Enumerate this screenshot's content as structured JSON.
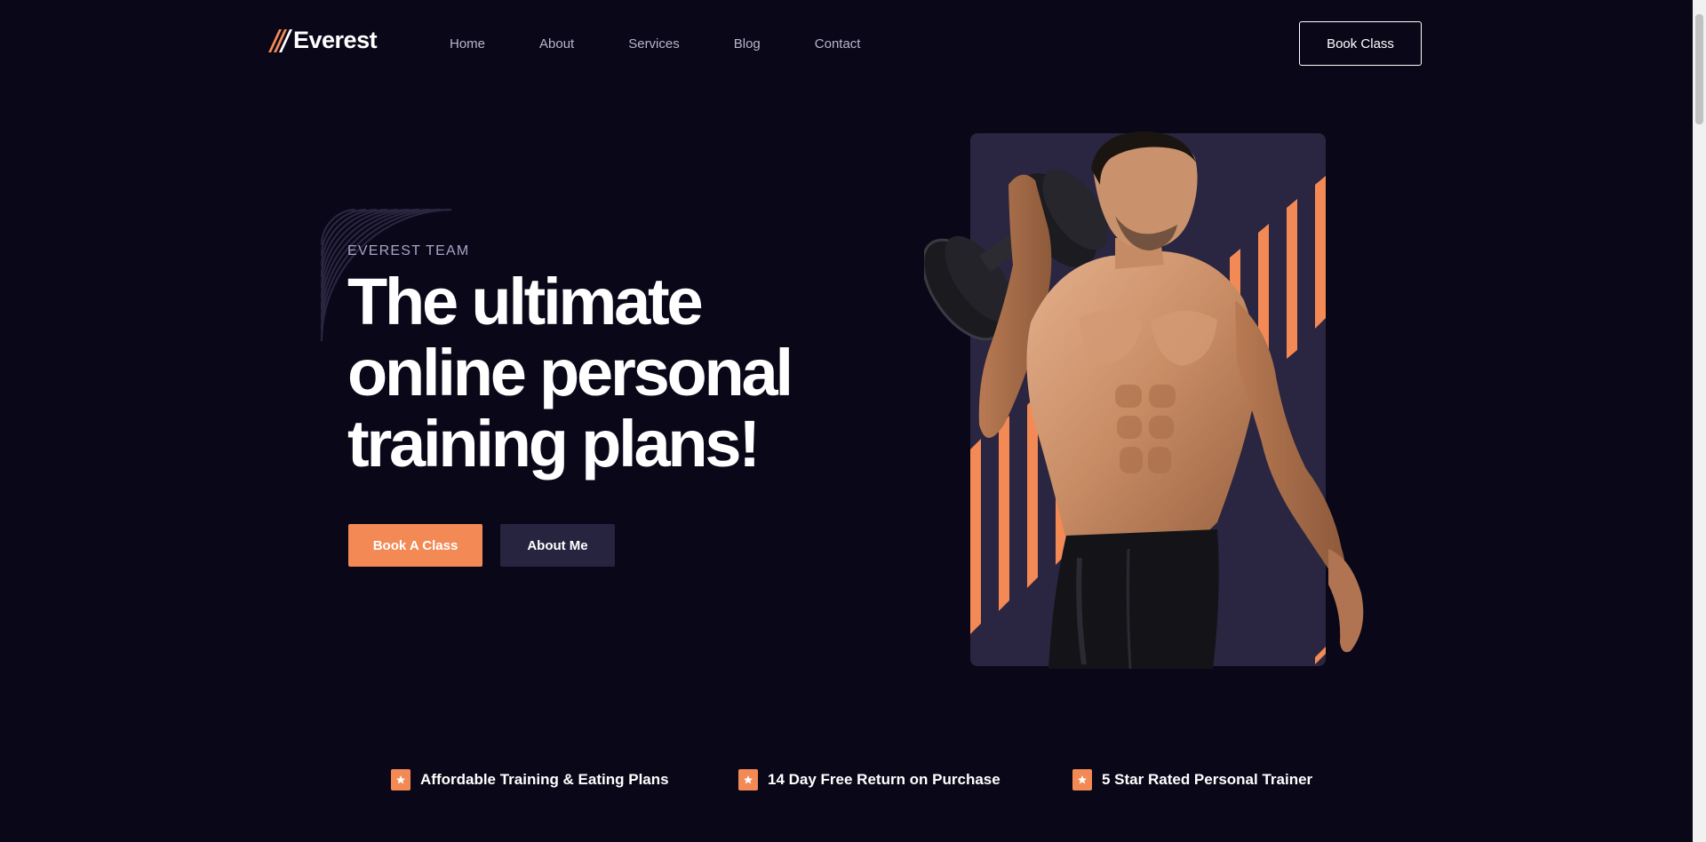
{
  "header": {
    "logo_text": "Everest",
    "nav": [
      "Home",
      "About",
      "Services",
      "Blog",
      "Contact"
    ],
    "cta_label": "Book Class"
  },
  "hero": {
    "eyebrow": "EVEREST TEAM",
    "title_lines": [
      "The ultimate",
      "online personal",
      "training plans!"
    ],
    "primary_button": "Book A Class",
    "secondary_button": "About Me",
    "image": "athlete-holding-dumbbell-photo"
  },
  "features": [
    {
      "icon": "star-icon",
      "label": "Affordable Training & Eating Plans"
    },
    {
      "icon": "star-icon",
      "label": "14 Day Free Return on Purchase"
    },
    {
      "icon": "star-icon",
      "label": "5 Star Rated Personal Trainer"
    }
  ],
  "colors": {
    "background": "#0a0718",
    "accent": "#f38a55",
    "panel": "#2a2540",
    "secondary_button": "#272440",
    "muted_text": "#b9b5cc"
  }
}
